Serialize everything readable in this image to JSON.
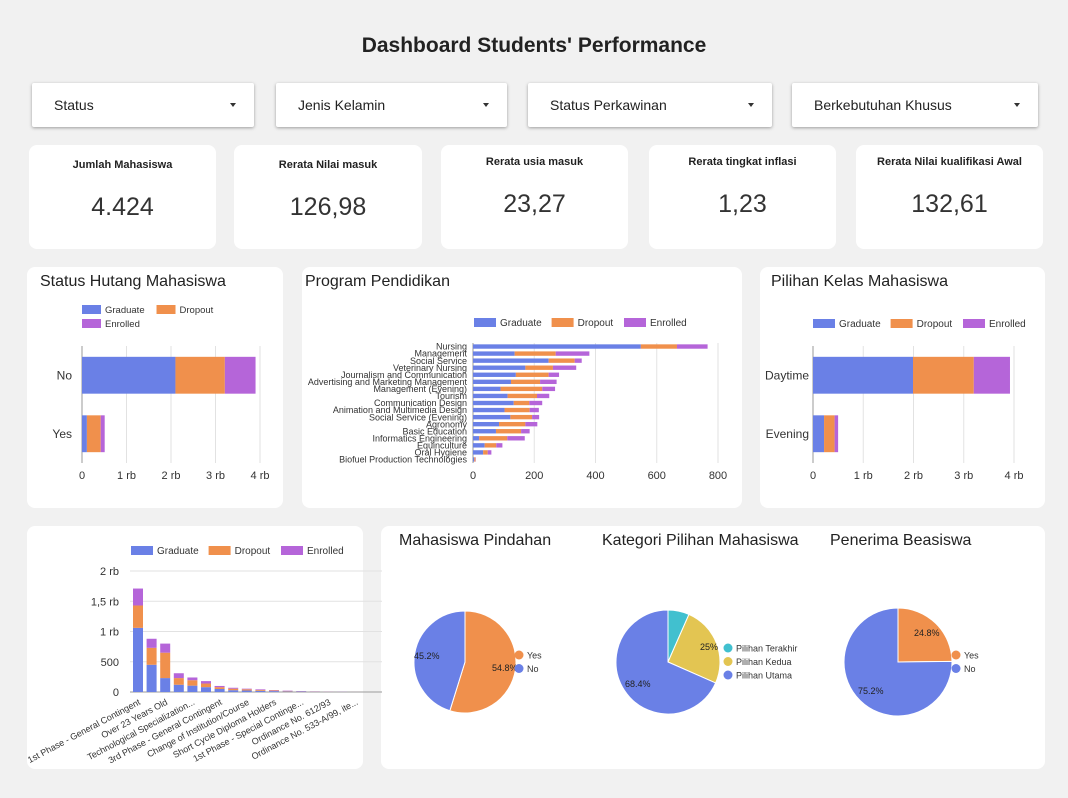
{
  "page": {
    "title": "Dashboard Students' Performance"
  },
  "filters": [
    {
      "label": "Status"
    },
    {
      "label": "Jenis Kelamin"
    },
    {
      "label": "Status Perkawinan"
    },
    {
      "label": "Berkebutuhan Khusus"
    }
  ],
  "kpis": [
    {
      "label": "Jumlah Mahasiswa",
      "value": "4.424"
    },
    {
      "label": "Rerata Nilai masuk",
      "value": "126,98"
    },
    {
      "label": "Rerata usia masuk",
      "value": "23,27"
    },
    {
      "label": "Rerata tingkat inflasi",
      "value": "1,23"
    },
    {
      "label": "Rerata Nilai kualifikasi Awal",
      "value": "132,61"
    }
  ],
  "colors": {
    "Graduate": "#6a80e6",
    "Dropout": "#f0904c",
    "Enrolled": "#b565d9",
    "background": "#f1f1f1",
    "grid": "#e2e2e2"
  },
  "chart_data": [
    {
      "id": "status_hutang",
      "type": "bar",
      "orientation": "horizontal",
      "stacked": true,
      "title": "Status Hutang Mahasiswa",
      "legend": "top-left",
      "categories": [
        "No",
        "Yes"
      ],
      "series": [
        {
          "name": "Graduate",
          "values": [
            2100,
            110
          ]
        },
        {
          "name": "Dropout",
          "values": [
            1110,
            310
          ]
        },
        {
          "name": "Enrolled",
          "values": [
            690,
            90
          ]
        }
      ],
      "xlim": [
        0,
        4000
      ],
      "ticks": [
        "0",
        "1 rb",
        "2 rb",
        "3 rb",
        "4 rb"
      ]
    },
    {
      "id": "program_pendidikan",
      "type": "bar",
      "orientation": "horizontal",
      "stacked": true,
      "title": "Program Pendidikan",
      "legend": "top",
      "categories": [
        "Nursing",
        "Management",
        "Social Service",
        "Veterinary Nursing",
        "Journalism and Communication",
        "Advertising and Marketing Management",
        "Management (Evening)",
        "Tourism",
        "Communication Design",
        "Animation and Multimedia Design",
        "Social Service (Evening)",
        "Agronomy",
        "Basic Education",
        "Informatics Engineering",
        "Equinculture",
        "Oral Hygiene",
        "Biofuel Production Technologies"
      ],
      "series": [
        {
          "name": "Graduate",
          "values": [
            548,
            136,
            247,
            171,
            140,
            124,
            90,
            113,
            133,
            103,
            122,
            85,
            75,
            20,
            38,
            33,
            4
          ]
        },
        {
          "name": "Dropout",
          "values": [
            118,
            134,
            85,
            90,
            107,
            95,
            136,
            96,
            51,
            82,
            71,
            86,
            82,
            92,
            38,
            15,
            4
          ]
        },
        {
          "name": "Enrolled",
          "values": [
            100,
            110,
            23,
            76,
            34,
            54,
            42,
            40,
            42,
            30,
            23,
            39,
            28,
            57,
            20,
            12,
            1
          ]
        }
      ],
      "xlim": [
        0,
        800
      ],
      "ticks": [
        "0",
        "200",
        "400",
        "600",
        "800"
      ]
    },
    {
      "id": "pilihan_kelas",
      "type": "bar",
      "orientation": "horizontal",
      "stacked": true,
      "title": "Pilihan Kelas Mahasiswa",
      "legend": "top",
      "categories": [
        "Daytime",
        "Evening"
      ],
      "series": [
        {
          "name": "Graduate",
          "values": [
            1990,
            220
          ]
        },
        {
          "name": "Dropout",
          "values": [
            1210,
            210
          ]
        },
        {
          "name": "Enrolled",
          "values": [
            720,
            70
          ]
        }
      ],
      "xlim": [
        0,
        4000
      ],
      "ticks": [
        "0",
        "1 rb",
        "2 rb",
        "3 rb",
        "4 rb"
      ]
    },
    {
      "id": "application_mode",
      "type": "bar",
      "orientation": "vertical",
      "stacked": true,
      "title": "",
      "legend": "top",
      "categories": [
        "1st Phase - General Contingent",
        "",
        "Over 23 Years Old",
        "",
        "Technological Specialization...",
        "",
        "3rd Phase - General Contingent",
        "",
        "Change of Institution/Course",
        "",
        "Short Cycle Diploma Holders",
        "",
        "1st Phase - Special Continge...",
        "",
        "Ordinance No. 612/93",
        "",
        "Ordinance No. 533-A/99, ite..."
      ],
      "series": [
        {
          "name": "Graduate",
          "values": [
            1060,
            450,
            230,
            120,
            105,
            80,
            50,
            30,
            25,
            20,
            15,
            10,
            8,
            5,
            3,
            2,
            1
          ]
        },
        {
          "name": "Dropout",
          "values": [
            370,
            280,
            420,
            110,
            90,
            60,
            30,
            25,
            20,
            15,
            10,
            8,
            5,
            3,
            2,
            1,
            1
          ]
        },
        {
          "name": "Enrolled",
          "values": [
            280,
            150,
            150,
            80,
            45,
            40,
            20,
            15,
            10,
            10,
            6,
            5,
            3,
            2,
            1,
            1,
            0
          ]
        }
      ],
      "ylim": [
        0,
        2000
      ],
      "ticks": [
        "0",
        "500",
        "1 rb",
        "1,5 rb",
        "2 rb"
      ]
    },
    {
      "id": "mahasiswa_pindahan",
      "type": "pie",
      "title": "Mahasiswa Pindahan",
      "legend": "right",
      "slices": [
        {
          "label": "Yes",
          "value": 54.8,
          "color": "#f0904c",
          "label_text": "54.8%"
        },
        {
          "label": "No",
          "value": 45.2,
          "color": "#6a80e6",
          "label_text": "45.2%"
        }
      ]
    },
    {
      "id": "kategori_pilihan",
      "type": "pie",
      "title": "Kategori Pilihan Mahasiswa",
      "legend": "right",
      "slices": [
        {
          "label": "Pilihan Terakhir",
          "value": 6.6,
          "color": "#41c0cf",
          "label_text": ""
        },
        {
          "label": "Pilihan Kedua",
          "value": 25,
          "color": "#e3c552",
          "label_text": "25%"
        },
        {
          "label": "Pilihan Utama",
          "value": 68.4,
          "color": "#6a80e6",
          "label_text": "68.4%"
        }
      ]
    },
    {
      "id": "penerima_beasiswa",
      "type": "pie",
      "title": "Penerima Beasiswa",
      "legend": "right",
      "slices": [
        {
          "label": "Yes",
          "value": 24.8,
          "color": "#f0904c",
          "label_text": "24.8%"
        },
        {
          "label": "No",
          "value": 75.2,
          "color": "#6a80e6",
          "label_text": "75.2%"
        }
      ]
    }
  ]
}
